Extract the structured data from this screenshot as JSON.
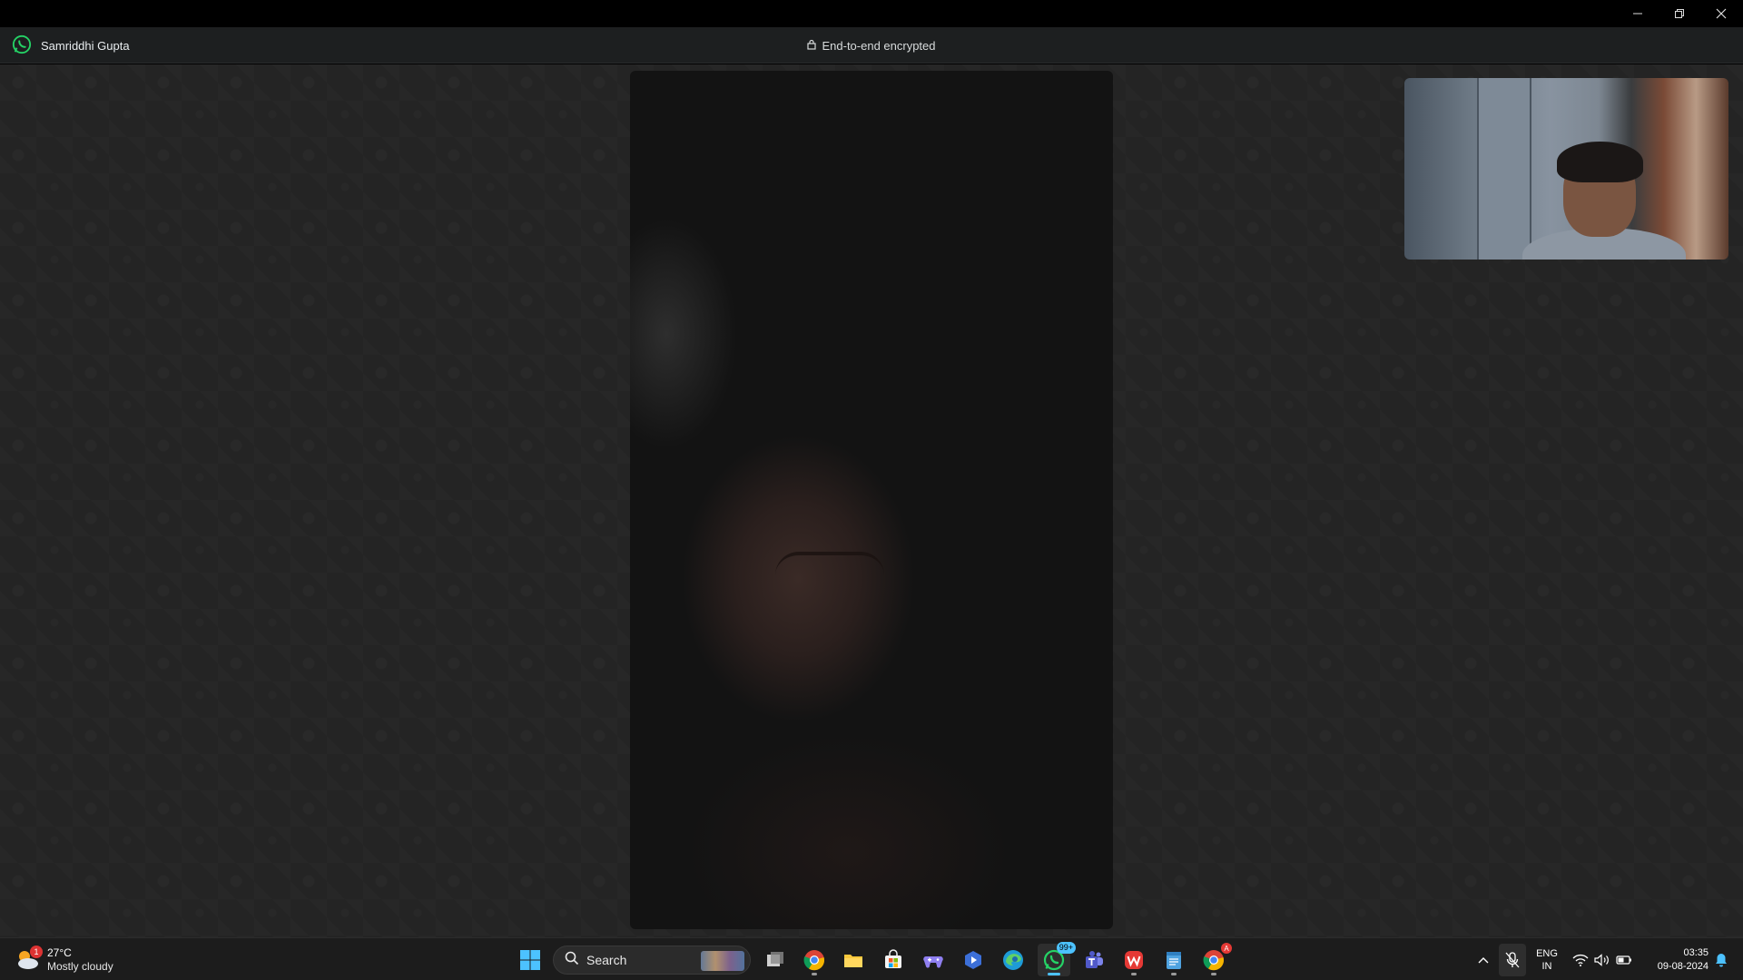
{
  "window": {
    "minimize_icon": "minimize-icon",
    "restore_icon": "restore-icon",
    "close_icon": "close-icon"
  },
  "call": {
    "contact_name": "Samriddhi Gupta",
    "encryption_label": "End-to-end encrypted",
    "app_icon": "whatsapp-icon",
    "lock_icon": "lock-icon"
  },
  "taskbar": {
    "weather": {
      "temperature": "27°C",
      "condition": "Mostly cloudy",
      "badge": "1"
    },
    "search": {
      "placeholder": "Search"
    },
    "apps": [
      {
        "name": "start",
        "icon": "windows-start-icon"
      },
      {
        "name": "task-view",
        "icon": "task-view-icon"
      },
      {
        "name": "chrome",
        "icon": "chrome-icon"
      },
      {
        "name": "file-explorer",
        "icon": "folder-icon"
      },
      {
        "name": "microsoft-store",
        "icon": "store-icon"
      },
      {
        "name": "game",
        "icon": "gamepad-icon"
      },
      {
        "name": "prime-video",
        "icon": "play-icon"
      },
      {
        "name": "edge",
        "icon": "edge-icon"
      },
      {
        "name": "whatsapp",
        "icon": "whatsapp-icon",
        "badge": "99+"
      },
      {
        "name": "teams",
        "icon": "teams-icon"
      },
      {
        "name": "wps-office",
        "icon": "wps-icon"
      },
      {
        "name": "notepad",
        "icon": "notepad-icon"
      },
      {
        "name": "chrome-profile",
        "icon": "chrome-icon",
        "badge": "A"
      }
    ],
    "tray": {
      "lang_line1": "ENG",
      "lang_line2": "IN",
      "time": "03:35",
      "date": "09-08-2024"
    }
  },
  "colors": {
    "whatsapp_green": "#25d366",
    "accent_blue": "#4cc2ff",
    "stage_bg": "#242424"
  }
}
